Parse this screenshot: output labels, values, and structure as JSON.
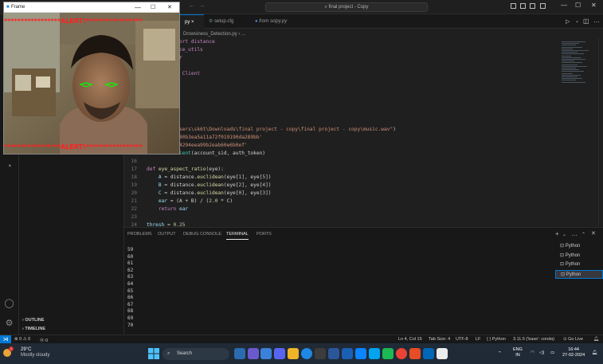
{
  "titlebar": {
    "search": "final project - Copy",
    "back": "←",
    "forward": "→"
  },
  "tabs": [
    {
      "label": "py",
      "active": true
    },
    {
      "label": "setup.cfg",
      "active": false
    },
    {
      "label": "from scipy.py",
      "active": false
    }
  ],
  "breadcrumb": "Drowsiness_Detection.py › ...",
  "code": [
    {
      "n": "",
      "segs": [
        [
          "kw",
          "spatial import distance"
        ]
      ]
    },
    {
      "n": "",
      "segs": [
        [
          "kw",
          "t import face_utils"
        ]
      ]
    },
    {
      "n": "",
      "segs": [
        [
          "kw",
          "import mixer"
        ]
      ]
    },
    {
      "n": "",
      "segs": [
        [
          "tx",
          "ls"
        ]
      ]
    },
    {
      "n": "",
      "segs": [
        [
          "kw",
          "rest import Client"
        ]
      ]
    },
    {
      "n": "",
      "segs": []
    },
    {
      "n": "",
      "segs": []
    },
    {
      "n": "",
      "segs": [
        [
          "tx",
          "der"
        ]
      ]
    },
    {
      "n": "",
      "segs": []
    },
    {
      "n": "",
      "segs": []
    },
    {
      "n": "",
      "segs": [
        [
          "tx",
          ")"
        ]
      ]
    },
    {
      "n": "",
      "segs": [
        [
          "fn",
          "load"
        ],
        [
          "tx",
          "("
        ],
        [
          "st",
          "r\"C:\\Users\\sk6t\\Downloads\\final project - copy\\final project - copy\\music.wav\""
        ],
        [
          "tx",
          ")"
        ]
      ]
    },
    {
      "n": "",
      "segs": [
        [
          "tx",
          "= "
        ],
        [
          "st",
          "'ACefdce980b3ea5a11a72f019190da289bb'"
        ]
      ]
    },
    {
      "n": "",
      "segs": [
        [
          "tx",
          "  "
        ],
        [
          "st",
          "'f3b6cedb4294eea99b2eab60e6b0ef'"
        ]
      ]
    },
    {
      "n": "15",
      "segs": [
        [
          "vr",
          "client"
        ],
        [
          "tx",
          " = "
        ],
        [
          "cl",
          "Client"
        ],
        [
          "tx",
          "(account_sid, auth_token)"
        ]
      ]
    },
    {
      "n": "16",
      "segs": []
    },
    {
      "n": "17",
      "segs": [
        [
          "kw",
          "def "
        ],
        [
          "fn",
          "eye_aspect_ratio"
        ],
        [
          "tx",
          "(eye):"
        ]
      ]
    },
    {
      "n": "18",
      "segs": [
        [
          "tx",
          "    "
        ],
        [
          "vr",
          "A"
        ],
        [
          "tx",
          " = distance."
        ],
        [
          "fn",
          "euclidean"
        ],
        [
          "tx",
          "(eye["
        ],
        [
          "nm",
          "1"
        ],
        [
          "tx",
          "], eye["
        ],
        [
          "nm",
          "5"
        ],
        [
          "tx",
          "])"
        ]
      ]
    },
    {
      "n": "19",
      "segs": [
        [
          "tx",
          "    "
        ],
        [
          "vr",
          "B"
        ],
        [
          "tx",
          " = distance."
        ],
        [
          "fn",
          "euclidean"
        ],
        [
          "tx",
          "(eye["
        ],
        [
          "nm",
          "2"
        ],
        [
          "tx",
          "], eye["
        ],
        [
          "nm",
          "4"
        ],
        [
          "tx",
          "])"
        ]
      ]
    },
    {
      "n": "20",
      "segs": [
        [
          "tx",
          "    "
        ],
        [
          "vr",
          "C"
        ],
        [
          "tx",
          " = distance."
        ],
        [
          "fn",
          "euclidean"
        ],
        [
          "tx",
          "(eye["
        ],
        [
          "nm",
          "0"
        ],
        [
          "tx",
          "], eye["
        ],
        [
          "nm",
          "3"
        ],
        [
          "tx",
          "])"
        ]
      ]
    },
    {
      "n": "21",
      "segs": [
        [
          "tx",
          "    "
        ],
        [
          "vr",
          "ear"
        ],
        [
          "tx",
          " = (A + B) / ("
        ],
        [
          "nm",
          "2.0"
        ],
        [
          "tx",
          " * C)"
        ]
      ]
    },
    {
      "n": "22",
      "segs": [
        [
          "tx",
          "    "
        ],
        [
          "kw",
          "return "
        ],
        [
          "vr",
          "ear"
        ]
      ]
    },
    {
      "n": "23",
      "segs": []
    },
    {
      "n": "24",
      "segs": [
        [
          "vr",
          "thresh"
        ],
        [
          "tx",
          " = "
        ],
        [
          "nm",
          "0.25"
        ]
      ]
    }
  ],
  "panel": {
    "tabs": [
      "PROBLEMS",
      "OUTPUT",
      "DEBUG CONSOLE",
      "TERMINAL",
      "PORTS"
    ],
    "active_tab": 3,
    "terminal_lines": [
      "59",
      "60",
      "61",
      "62",
      "63",
      "64",
      "65",
      "66",
      "67",
      "68",
      "69",
      "70"
    ],
    "terminals": [
      "Python",
      "Python",
      "Python",
      "Python"
    ]
  },
  "sidebar": {
    "outline": "OUTLINE",
    "timeline": "TIMELINE"
  },
  "status": {
    "problems": "⊗ 0 ⚠ 0",
    "ports": "ⓦ 0",
    "position": "Ln 4, Col 15",
    "tab": "Tab Size: 4",
    "encoding": "UTF-8",
    "eol": "LF",
    "language": "{ } Python",
    "interpreter": "3.11.5 ('base': conda)",
    "golive": "⊙ Go Live"
  },
  "taskbar": {
    "temp": "29°C",
    "weather": "Mostly cloudy",
    "search": "Search",
    "lang_top": "ENG",
    "lang_bottom": "IN",
    "time": "16:44",
    "date": "27-02-2024"
  },
  "frame": {
    "title": "Frame",
    "alert": "*****************ALERT!*****************"
  },
  "colors": {
    "accent": "#0078d4",
    "alert": "#ff2020",
    "eyes": "#00ff00"
  }
}
